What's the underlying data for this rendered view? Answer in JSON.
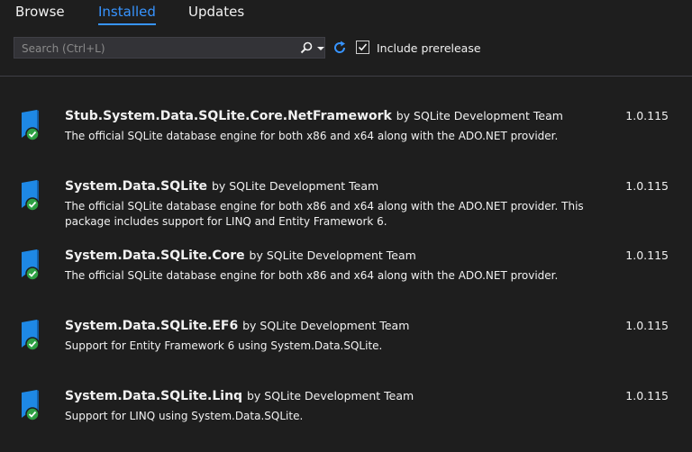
{
  "tabs": [
    {
      "label": "Browse",
      "active": false
    },
    {
      "label": "Installed",
      "active": true
    },
    {
      "label": "Updates",
      "active": false
    }
  ],
  "search": {
    "placeholder": "Search (Ctrl+L)",
    "value": "",
    "icon": "search-icon"
  },
  "include_prerelease": {
    "label": "Include prerelease",
    "checked": true
  },
  "packages": [
    {
      "name": "Stub.System.Data.SQLite.Core.NetFramework",
      "by": "by SQLite Development Team",
      "description": "The official SQLite database engine for both x86 and x64 along with the ADO.NET provider.",
      "version": "1.0.115"
    },
    {
      "name": "System.Data.SQLite",
      "by": "by SQLite Development Team",
      "description": "The official SQLite database engine for both x86 and x64 along with the ADO.NET provider.  This package includes support for LINQ and Entity Framework 6.",
      "version": "1.0.115"
    },
    {
      "name": "System.Data.SQLite.Core",
      "by": "by SQLite Development Team",
      "description": "The official SQLite database engine for both x86 and x64 along with the ADO.NET provider.",
      "version": "1.0.115"
    },
    {
      "name": "System.Data.SQLite.EF6",
      "by": "by SQLite Development Team",
      "description": "Support for Entity Framework 6 using System.Data.SQLite.",
      "version": "1.0.115"
    },
    {
      "name": "System.Data.SQLite.Linq",
      "by": "by SQLite Development Team",
      "description": "Support for LINQ using System.Data.SQLite.",
      "version": "1.0.115"
    }
  ],
  "colors": {
    "background": "#1e1e1e",
    "accent": "#3794ff",
    "installed_badge": "#2ea043",
    "package_icon": "#1e88e5"
  }
}
